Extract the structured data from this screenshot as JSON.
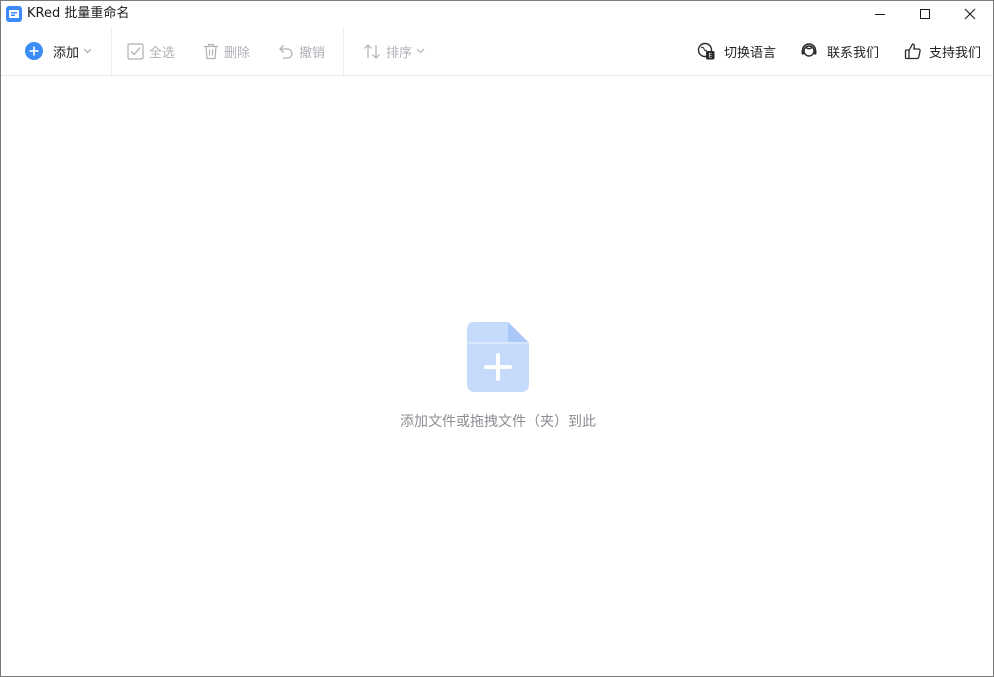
{
  "window": {
    "title": "KRed 批量重命名"
  },
  "toolbar": {
    "add_label": "添加",
    "select_all_label": "全选",
    "delete_label": "删除",
    "undo_label": "撤销",
    "sort_label": "排序",
    "switch_language_label": "切换语言",
    "contact_us_label": "联系我们",
    "support_us_label": "支持我们"
  },
  "main": {
    "empty_hint": "添加文件或拖拽文件（夹）到此"
  },
  "colors": {
    "accent": "#3b8cf7",
    "disabled": "#aeb1b6",
    "empty_icon": "#c6dbfb"
  }
}
